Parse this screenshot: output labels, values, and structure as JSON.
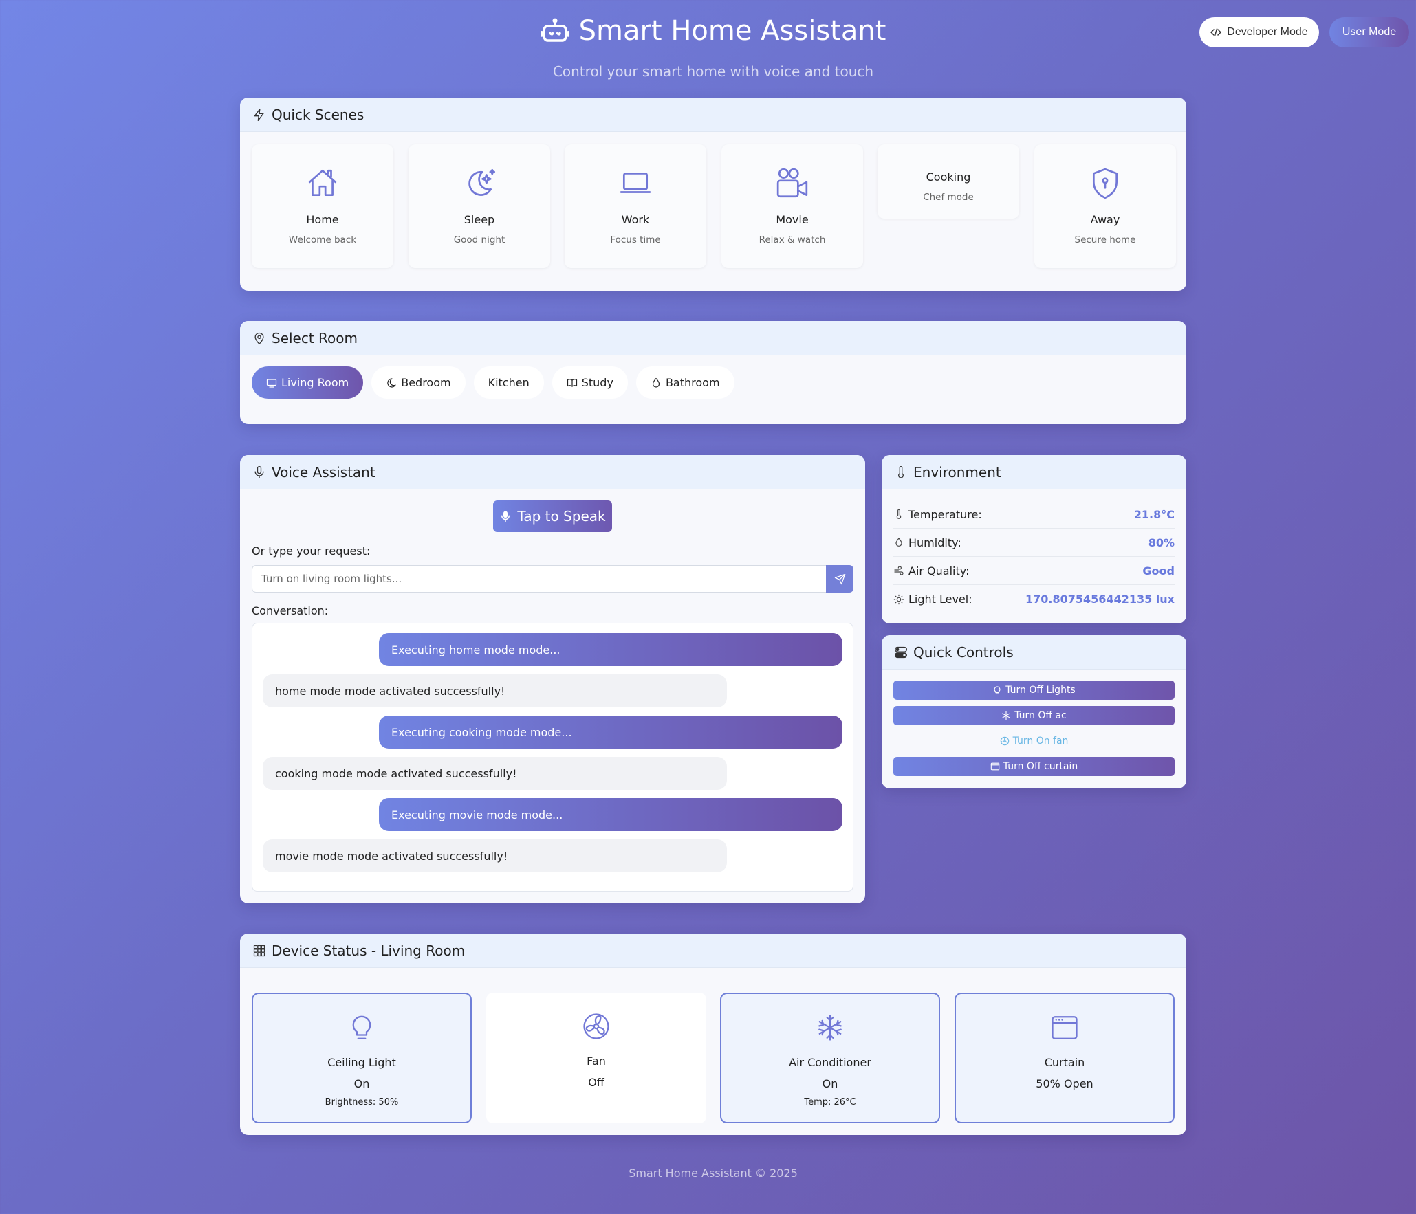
{
  "header": {
    "title": "Smart Home Assistant",
    "subtitle": "Control your smart home with voice and touch",
    "logo_icon": "robot-icon",
    "developer_mode_label": "Developer Mode",
    "user_mode_label": "User Mode"
  },
  "scenes": {
    "title": "Quick Scenes",
    "items": [
      {
        "name": "Home",
        "desc": "Welcome back",
        "icon": "house-icon"
      },
      {
        "name": "Sleep",
        "desc": "Good night",
        "icon": "moon-stars-icon"
      },
      {
        "name": "Work",
        "desc": "Focus time",
        "icon": "laptop-icon"
      },
      {
        "name": "Movie",
        "desc": "Relax & watch",
        "icon": "camera-reels-icon"
      },
      {
        "name": "Cooking",
        "desc": "Chef mode",
        "icon": ""
      },
      {
        "name": "Away",
        "desc": "Secure home",
        "icon": "shield-lock-icon"
      }
    ]
  },
  "rooms": {
    "title": "Select Room",
    "items": [
      {
        "label": "Living Room",
        "icon": "tv-icon",
        "active": true
      },
      {
        "label": "Bedroom",
        "icon": "moon-icon",
        "active": false
      },
      {
        "label": "Kitchen",
        "icon": "",
        "active": false
      },
      {
        "label": "Study",
        "icon": "book-icon",
        "active": false
      },
      {
        "label": "Bathroom",
        "icon": "droplet-icon",
        "active": false
      }
    ]
  },
  "voice": {
    "title": "Voice Assistant",
    "tap_label": "Tap to Speak",
    "type_label": "Or type your request:",
    "input_placeholder": "Turn on living room lights...",
    "conversation_label": "Conversation:",
    "messages": [
      {
        "from": "user",
        "text": "Executing home mode mode..."
      },
      {
        "from": "assistant",
        "text": "home mode mode activated successfully!"
      },
      {
        "from": "user",
        "text": "Executing cooking mode mode..."
      },
      {
        "from": "assistant",
        "text": "cooking mode mode activated successfully!"
      },
      {
        "from": "user",
        "text": "Executing movie mode mode..."
      },
      {
        "from": "assistant",
        "text": "movie mode mode activated successfully!"
      }
    ]
  },
  "environment": {
    "title": "Environment",
    "rows": [
      {
        "label": "Temperature:",
        "value": "21.8°C",
        "icon": "thermometer-icon"
      },
      {
        "label": "Humidity:",
        "value": "80%",
        "icon": "droplet-icon"
      },
      {
        "label": "Air Quality:",
        "value": "Good",
        "icon": "wind-icon"
      },
      {
        "label": "Light Level:",
        "value": "170.8075456442135 lux",
        "icon": "sun-icon"
      }
    ]
  },
  "quick_controls": {
    "title": "Quick Controls",
    "items": [
      {
        "label": "Turn Off Lights",
        "icon": "lightbulb-icon",
        "style": "filled"
      },
      {
        "label": "Turn Off ac",
        "icon": "snowflake-icon",
        "style": "filled"
      },
      {
        "label": "Turn On fan",
        "icon": "fan-icon",
        "style": "plain"
      },
      {
        "label": "Turn Off curtain",
        "icon": "window-icon",
        "style": "filled"
      }
    ]
  },
  "devices": {
    "title": "Device Status - Living Room",
    "items": [
      {
        "name": "Ceiling Light",
        "state": "On",
        "extra": "Brightness: 50%",
        "icon": "lightbulb-icon",
        "on": true
      },
      {
        "name": "Fan",
        "state": "Off",
        "extra": "",
        "icon": "fan-icon",
        "on": false
      },
      {
        "name": "Air Conditioner",
        "state": "On",
        "extra": "Temp: 26°C",
        "icon": "snowflake-icon",
        "on": true
      },
      {
        "name": "Curtain",
        "state": "50% Open",
        "extra": "",
        "icon": "window-icon",
        "on": true
      }
    ]
  },
  "footer": "Smart Home Assistant © 2025",
  "colors": {
    "accent": "#7184e2",
    "accent_end": "#6f55ab",
    "value_text": "#6879dd",
    "header_bg": "#e9f1fd"
  }
}
